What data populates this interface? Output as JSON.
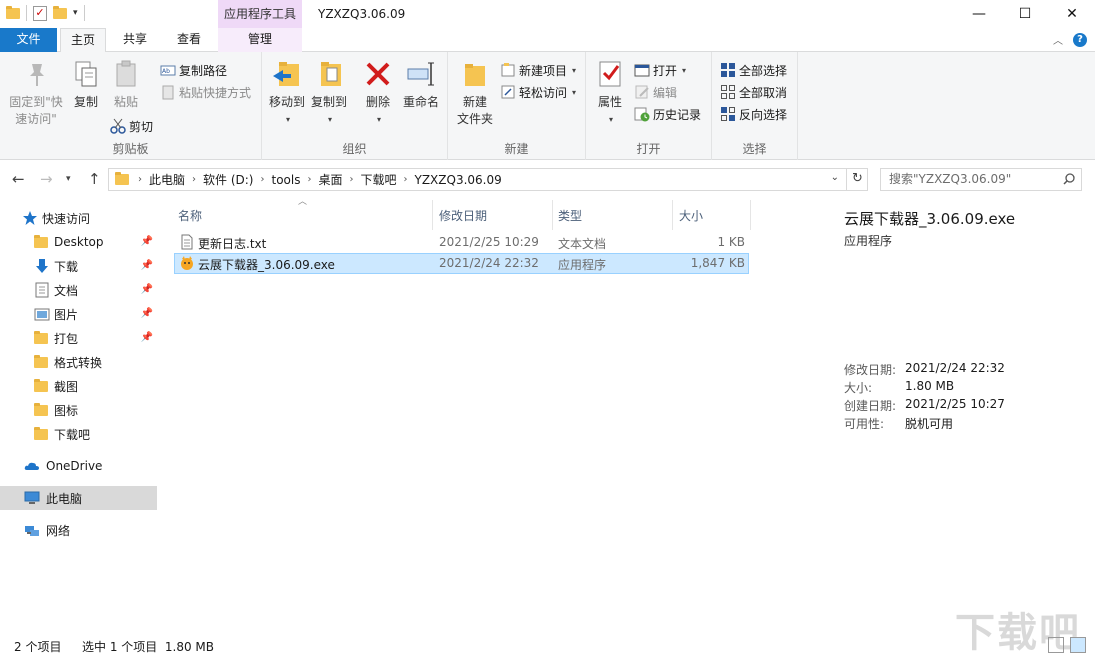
{
  "titlebar": {
    "context_tab_title": "应用程序工具",
    "window_title": "YZXZQ3.06.09",
    "minimize": "—",
    "maximize": "☐",
    "close": "✕"
  },
  "tabs": {
    "file": "文件",
    "home": "主页",
    "share": "共享",
    "view": "查看",
    "manage": "管理"
  },
  "ribbon": {
    "clipboard": {
      "label": "剪贴板",
      "pin_quick_line1": "固定到\"快",
      "pin_quick_line2": "速访问\"",
      "copy": "复制",
      "paste": "粘贴",
      "copy_path": "复制路径",
      "paste_shortcut": "粘贴快捷方式",
      "cut": "剪切"
    },
    "organize": {
      "label": "组织",
      "move_to": "移动到",
      "copy_to": "复制到",
      "delete": "删除",
      "rename": "重命名"
    },
    "new": {
      "label": "新建",
      "new_folder_line1": "新建",
      "new_folder_line2": "文件夹",
      "new_item": "新建项目",
      "easy_access": "轻松访问"
    },
    "open": {
      "label": "打开",
      "properties": "属性",
      "open": "打开",
      "edit": "编辑",
      "history": "历史记录"
    },
    "select": {
      "label": "选择",
      "select_all": "全部选择",
      "select_none": "全部取消",
      "invert": "反向选择"
    }
  },
  "address": {
    "crumbs": [
      "此电脑",
      "软件 (D:)",
      "tools",
      "桌面",
      "下载吧",
      "YZXZQ3.06.09"
    ],
    "search_placeholder": "搜索\"YZXZQ3.06.09\""
  },
  "nav": {
    "quick_access": "快速访问",
    "items": [
      "Desktop",
      "下载",
      "文档",
      "图片",
      "打包",
      "格式转换",
      "截图",
      "图标",
      "下载吧"
    ],
    "onedrive": "OneDrive",
    "this_pc": "此电脑",
    "network": "网络"
  },
  "columns": {
    "name": "名称",
    "modified": "修改日期",
    "type": "类型",
    "size": "大小"
  },
  "files": [
    {
      "name": "更新日志.txt",
      "modified": "2021/2/25 10:29",
      "type": "文本文档",
      "size": "1 KB"
    },
    {
      "name": "云展下载器_3.06.09.exe",
      "modified": "2021/2/24 22:32",
      "type": "应用程序",
      "size": "1,847 KB"
    }
  ],
  "details": {
    "name": "云展下载器_3.06.09.exe",
    "type": "应用程序",
    "props": [
      {
        "k": "修改日期:",
        "v": "2021/2/24 22:32"
      },
      {
        "k": "大小:",
        "v": "1.80 MB"
      },
      {
        "k": "创建日期:",
        "v": "2021/2/25 10:27"
      },
      {
        "k": "可用性:",
        "v": "脱机可用"
      }
    ]
  },
  "status": {
    "count": "2 个项目",
    "selected": "选中 1 个项目  1.80 MB"
  },
  "watermark": "下载吧",
  "colors": {
    "accent": "#1979ca",
    "selection": "#cce8ff",
    "context_tab": "#efd9f7",
    "ribbon_bg": "#f5f6f7"
  }
}
